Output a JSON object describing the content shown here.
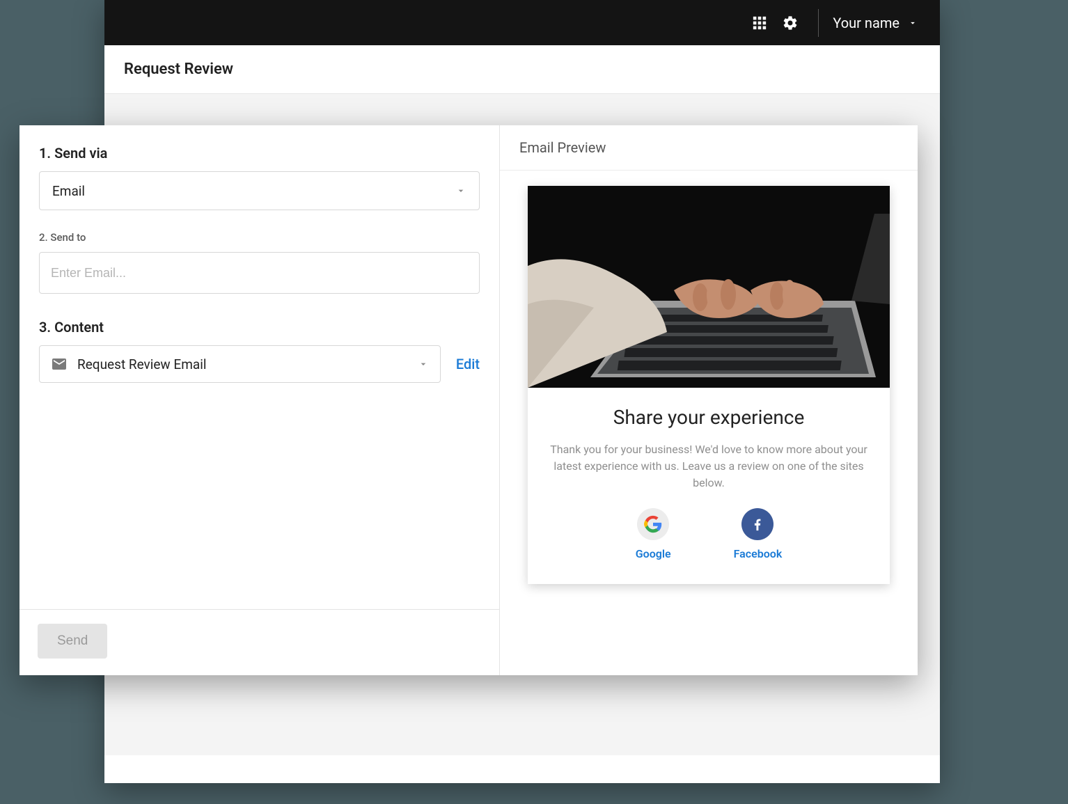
{
  "topbar": {
    "user_label": "Your name"
  },
  "page": {
    "title": "Request Review"
  },
  "form": {
    "step1_label": "1. Send via",
    "send_via_value": "Email",
    "step2_label": "2. Send to",
    "send_to_placeholder": "Enter Email...",
    "send_to_value": "",
    "step3_label": "3. Content",
    "content_value": "Request Review Email",
    "edit_label": "Edit",
    "send_button": "Send"
  },
  "preview": {
    "header": "Email Preview",
    "title": "Share your experience",
    "body": "Thank you for your business! We'd love to know more about your latest experience with us. Leave us a review on one of the sites below.",
    "sites": {
      "google": "Google",
      "facebook": "Facebook"
    }
  }
}
